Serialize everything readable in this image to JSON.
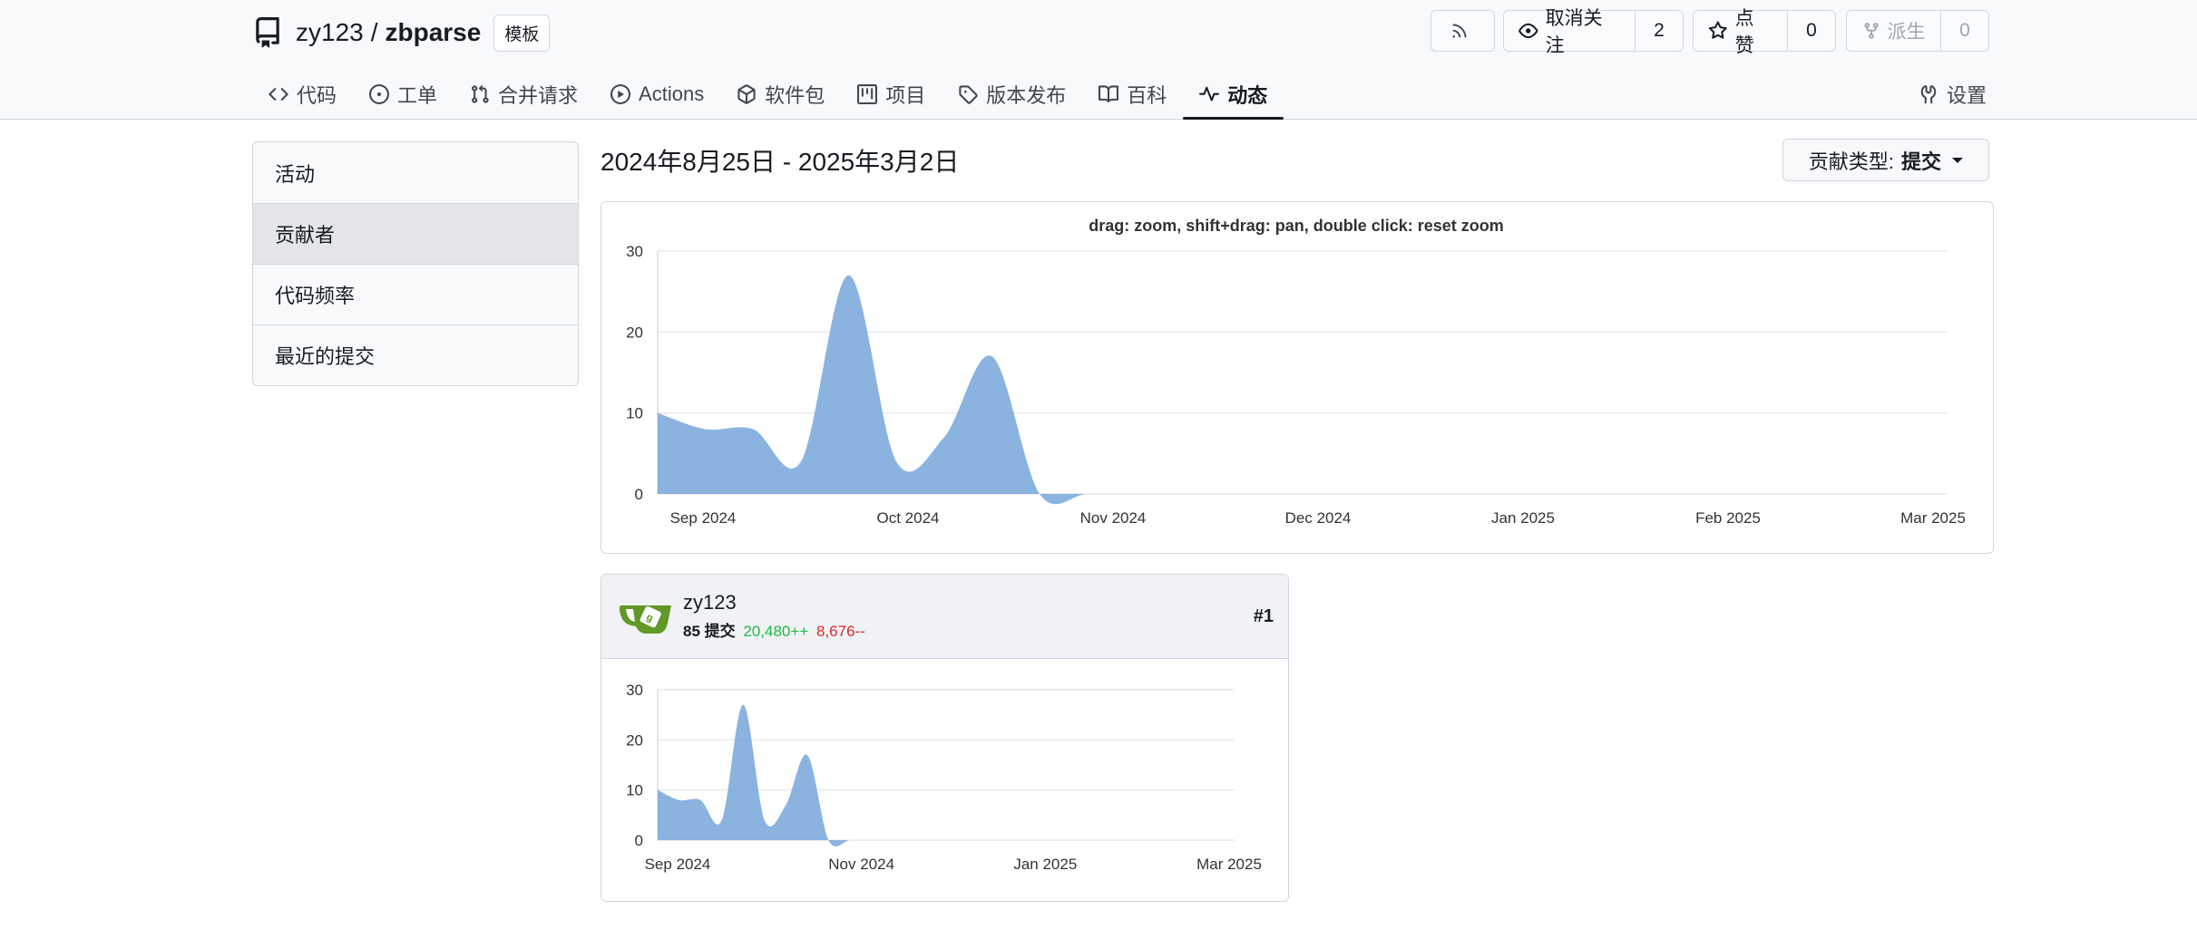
{
  "repo": {
    "owner": "zy123",
    "separator": "/",
    "name": "zbparse",
    "badge": "模板"
  },
  "header_buttons": {
    "rss_icon": "rss-icon",
    "unwatch": {
      "label": "取消关注",
      "count": "2"
    },
    "star": {
      "label": "点赞",
      "count": "0"
    },
    "fork": {
      "label": "派生",
      "count": "0"
    }
  },
  "tabs": [
    {
      "label": "代码",
      "icon": "code-icon"
    },
    {
      "label": "工单",
      "icon": "issue-icon"
    },
    {
      "label": "合并请求",
      "icon": "pull-request-icon"
    },
    {
      "label": "Actions",
      "icon": "actions-icon"
    },
    {
      "label": "软件包",
      "icon": "package-icon"
    },
    {
      "label": "项目",
      "icon": "project-icon"
    },
    {
      "label": "版本发布",
      "icon": "tag-icon"
    },
    {
      "label": "百科",
      "icon": "book-icon"
    },
    {
      "label": "动态",
      "icon": "pulse-icon",
      "active": true
    }
  ],
  "settings_label": "设置",
  "sidebar": {
    "items": [
      {
        "label": "活动"
      },
      {
        "label": "贡献者",
        "active": true
      },
      {
        "label": "代码频率"
      },
      {
        "label": "最近的提交"
      }
    ]
  },
  "date_range": "2024年8月25日 - 2025年3月2日",
  "contrib_type": {
    "label": "贡献类型:",
    "value": "提交"
  },
  "accent_color": "#6ea0d8",
  "chart_data": [
    {
      "type": "area",
      "title": "drag: zoom, shift+drag: pan, double click: reset zoom",
      "x": [
        "2024-08-25",
        "2024-09-01",
        "2024-09-08",
        "2024-09-15",
        "2024-09-22",
        "2024-09-29",
        "2024-10-06",
        "2024-10-13",
        "2024-10-20",
        "2024-10-27",
        "2024-11-03",
        "2024-11-10",
        "2024-11-17",
        "2024-11-24",
        "2024-12-01",
        "2024-12-08",
        "2024-12-15",
        "2024-12-22",
        "2024-12-29",
        "2025-01-05",
        "2025-01-12",
        "2025-01-19",
        "2025-01-26",
        "2025-02-02",
        "2025-02-09",
        "2025-02-16",
        "2025-02-23",
        "2025-03-02"
      ],
      "values": [
        10,
        8,
        8,
        4,
        27,
        4,
        7,
        17,
        0,
        0,
        0,
        0,
        0,
        0,
        0,
        0,
        0,
        0,
        0,
        0,
        0,
        0,
        0,
        0,
        0,
        0,
        0,
        0
      ],
      "ylim": [
        0,
        30
      ],
      "yticks": [
        "0",
        "10",
        "20",
        "30"
      ],
      "xtick_labels": [
        "Sep 2024",
        "Oct 2024",
        "Nov 2024",
        "Dec 2024",
        "Jan 2025",
        "Feb 2025",
        "Mar 2025"
      ],
      "grid": true
    },
    {
      "type": "area",
      "x": [
        "2024-08-25",
        "2024-09-01",
        "2024-09-08",
        "2024-09-15",
        "2024-09-22",
        "2024-09-29",
        "2024-10-06",
        "2024-10-13",
        "2024-10-20",
        "2024-10-27",
        "2024-11-03",
        "2024-11-10",
        "2024-11-17",
        "2024-11-24",
        "2024-12-01",
        "2024-12-08",
        "2024-12-15",
        "2024-12-22",
        "2024-12-29",
        "2025-01-05",
        "2025-01-12",
        "2025-01-19",
        "2025-01-26",
        "2025-02-02",
        "2025-02-09",
        "2025-02-16",
        "2025-02-23",
        "2025-03-02"
      ],
      "values": [
        10,
        8,
        8,
        4,
        27,
        4,
        7,
        17,
        0,
        0,
        0,
        0,
        0,
        0,
        0,
        0,
        0,
        0,
        0,
        0,
        0,
        0,
        0,
        0,
        0,
        0,
        0,
        0
      ],
      "ylim": [
        0,
        30
      ],
      "yticks": [
        "0",
        "10",
        "20",
        "30"
      ],
      "xtick_labels": [
        "Sep 2024",
        "Nov 2024",
        "Jan 2025",
        "Mar 2025"
      ],
      "grid": true
    }
  ],
  "contributor": {
    "name": "zy123",
    "commits": "85",
    "commits_label": "提交",
    "additions": "20,480++",
    "deletions": "8,676--",
    "rank": "#1"
  }
}
